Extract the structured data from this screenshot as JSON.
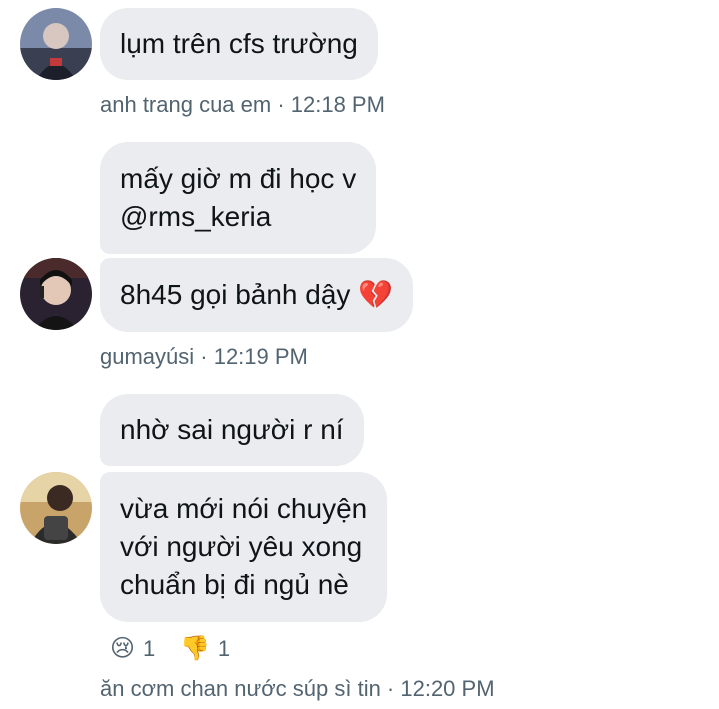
{
  "messages": [
    {
      "text": "lụm trên cfs trường"
    },
    {
      "text": "mấy giờ m đi học v\n@rms_keria"
    },
    {
      "text": "8h45 gọi bảnh dậy 💔"
    },
    {
      "text": "nhờ sai người r ní"
    },
    {
      "text": "vừa mới nói chuyện\nvới người yêu xong\nchuẩn bị đi ngủ nè"
    }
  ],
  "meta": [
    {
      "label": "anh trang cua em · 12:18 PM"
    },
    {
      "label": "gumayúsi · 12:19 PM"
    },
    {
      "label": "ăn cơm chan nước súp sì tin · 12:20 PM"
    }
  ],
  "reactions": [
    {
      "emoji": "😢",
      "icon": "crying-face-icon",
      "count": "1"
    },
    {
      "emoji": "👎",
      "icon": "thumbs-down-icon",
      "count": "1"
    }
  ],
  "colors": {
    "bubble": "#eaecf0",
    "text": "#0f1419",
    "meta": "#536471"
  }
}
